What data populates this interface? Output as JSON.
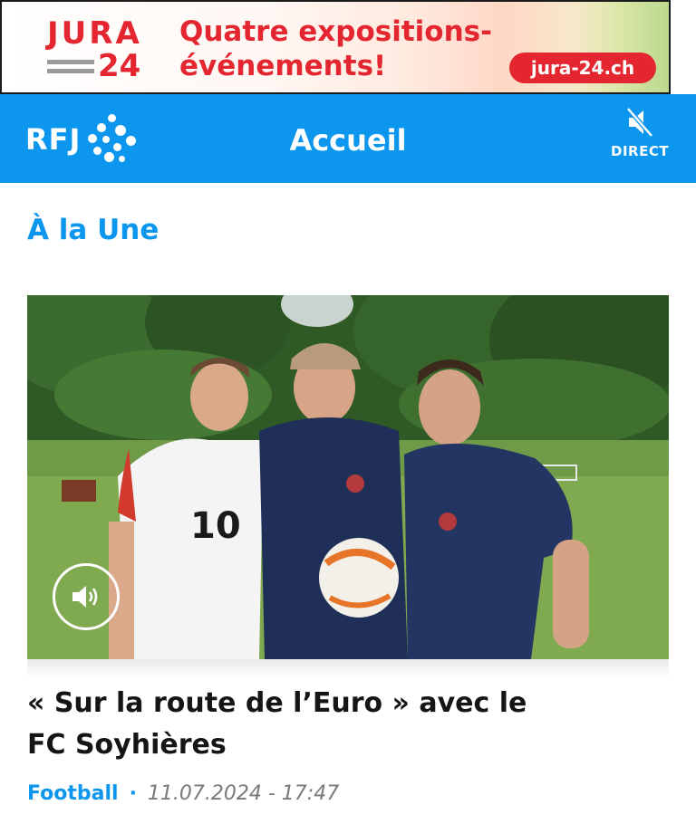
{
  "ad": {
    "brand_top": "JURA",
    "brand_bottom": "24",
    "headline_line1": "Quatre expositions-",
    "headline_line2": "événements!",
    "url_label": "jura-24.ch"
  },
  "header": {
    "logo_text": "RFJ",
    "title": "Accueil",
    "direct_label": "DIRECT",
    "direct_icon": "speaker-muted-icon"
  },
  "section": {
    "title": "À la Une"
  },
  "article": {
    "image_description_icon": "photo",
    "audio_icon": "speaker-icon",
    "title_line1": "« Sur la route de l’Euro » avec le",
    "title_line2": "FC Soyhières",
    "category": "Football",
    "separator": "·",
    "date": "11.07.2024 - 17:47",
    "jersey_number": "10"
  },
  "colors": {
    "brand_blue": "#0d96ee",
    "ad_red": "#e3262f"
  }
}
